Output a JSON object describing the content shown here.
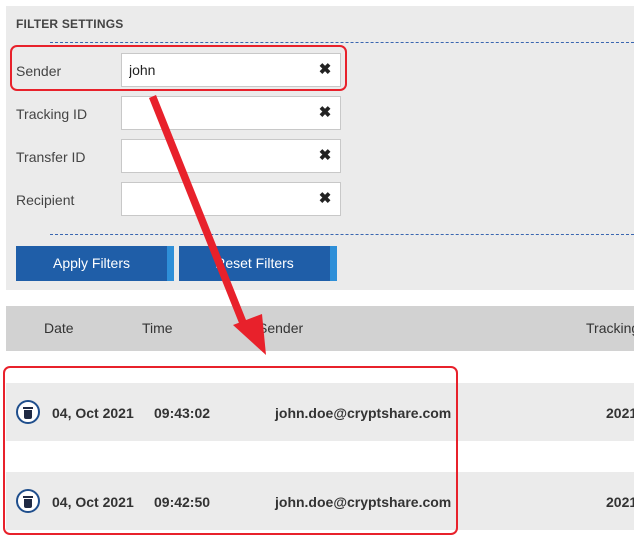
{
  "filters": {
    "title": "FILTER SETTINGS",
    "sender": {
      "label": "Sender",
      "value": "john"
    },
    "tracking_id": {
      "label": "Tracking ID",
      "value": ""
    },
    "transfer_id": {
      "label": "Transfer ID",
      "value": ""
    },
    "recipient": {
      "label": "Recipient",
      "value": ""
    },
    "clear_glyph": "✖",
    "apply_label": "Apply Filters",
    "reset_label": "Reset Filters"
  },
  "table": {
    "columns": [
      "Date",
      "Time",
      "Sender",
      "Tracking"
    ],
    "rows": [
      {
        "date": "04, Oct 2021",
        "time": "09:43:02",
        "sender": "john.doe@cryptshare.com",
        "tracking": "2021"
      },
      {
        "date": "04, Oct 2021",
        "time": "09:42:50",
        "sender": "john.doe@cryptshare.com",
        "tracking": "2021"
      }
    ]
  },
  "icons": {
    "clear": "close-icon",
    "delete": "trash-icon"
  },
  "colors": {
    "button": "#1f5ea8",
    "button_edge": "#2e8fd8",
    "annotation": "#e8212b",
    "panel_bg": "#ebebeb",
    "header_bg": "#d2d2d2",
    "divider": "#3a66b0"
  }
}
